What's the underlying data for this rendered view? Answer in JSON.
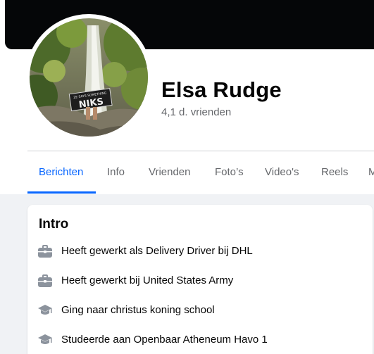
{
  "profile": {
    "name": "Elsa Rudge",
    "friends_count": "4,1 d. vrienden",
    "avatar_sign_text": "NIKS",
    "avatar_sign_subtext": "ZE SAYS SOMETHING"
  },
  "tabs": [
    {
      "label": "Berichten",
      "active": true
    },
    {
      "label": "Info",
      "active": false
    },
    {
      "label": "Vrienden",
      "active": false
    },
    {
      "label": "Foto’s",
      "active": false
    },
    {
      "label": "Video's",
      "active": false
    },
    {
      "label": "Reels",
      "active": false
    },
    {
      "label": "M",
      "active": false
    }
  ],
  "intro": {
    "title": "Intro",
    "items": [
      {
        "icon": "briefcase-icon",
        "prefix": "Heeft gewerkt als Delivery Driver bij ",
        "link": "DHL"
      },
      {
        "icon": "briefcase-icon",
        "prefix": "Heeft gewerkt bij ",
        "link": "United States Army"
      },
      {
        "icon": "graduation-cap-icon",
        "prefix": "Ging naar ",
        "link": "christus koning school"
      },
      {
        "icon": "graduation-cap-icon",
        "prefix": "Studeerde aan ",
        "link": "Openbaar Atheneum Havo 1"
      }
    ]
  },
  "colors": {
    "accent": "#0866ff",
    "secondary_text": "#65676b",
    "page_bg": "#f0f2f5",
    "cover": "#050608"
  }
}
